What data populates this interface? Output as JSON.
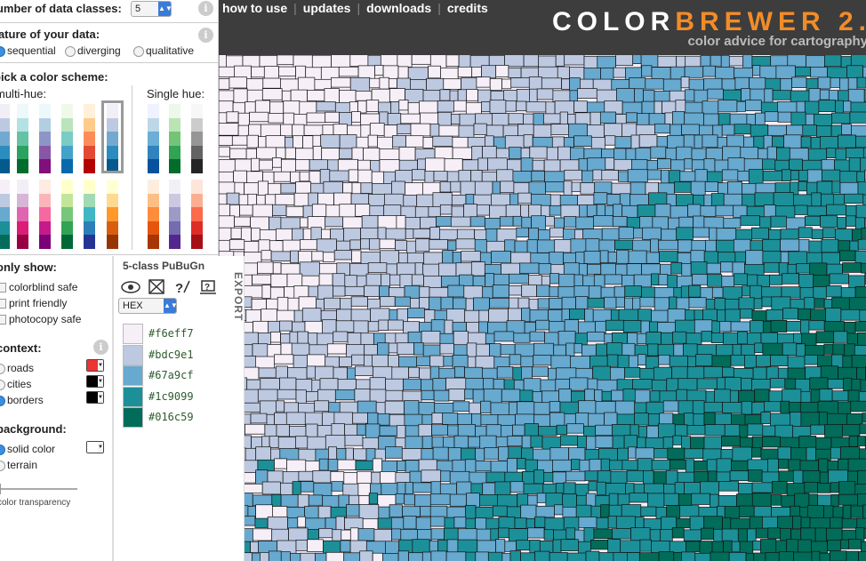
{
  "nav": {
    "items": [
      "how to use",
      "updates",
      "downloads",
      "credits"
    ]
  },
  "brand": {
    "title_a": "COLOR",
    "title_b": "BREWER 2.",
    "tagline": "color advice for cartography"
  },
  "classes": {
    "label": "number of data classes:",
    "value": "5"
  },
  "nature": {
    "label": "nature of your data:",
    "options": [
      "sequential",
      "diverging",
      "qualitative"
    ],
    "selected": "sequential"
  },
  "scheme": {
    "label": "pick a color scheme:",
    "multi_label": "multi-hue:",
    "single_label": "Single hue:"
  },
  "show": {
    "label": "only show:",
    "options": [
      "colorblind safe",
      "print friendly",
      "photocopy safe"
    ]
  },
  "context": {
    "label": "context:",
    "items": [
      "roads",
      "cities",
      "borders"
    ],
    "colors": [
      "#ee3333",
      "#000000",
      "#000000"
    ]
  },
  "background": {
    "label": "background:",
    "options": [
      "solid color",
      "terrain"
    ],
    "transparency_label": "color transparency"
  },
  "legend": {
    "title": "5-class PuBuGn",
    "format": "HEX",
    "export": "EXPORT",
    "colors": [
      "#f6eff7",
      "#bdc9e1",
      "#67a9cf",
      "#1c9099",
      "#016c59"
    ]
  },
  "multi_hue": [
    [
      "#f1eef6",
      "#bdc9e1",
      "#74a9cf",
      "#2b8cbe",
      "#045a8d"
    ],
    [
      "#edf8fb",
      "#b2e2e2",
      "#66c2a4",
      "#2ca25f",
      "#006d2c"
    ],
    [
      "#edf8fb",
      "#b3cde3",
      "#8c96c6",
      "#8856a7",
      "#810f7c"
    ],
    [
      "#f0f9e8",
      "#bae4bc",
      "#7bccc4",
      "#43a2ca",
      "#0868ac"
    ],
    [
      "#fef0d9",
      "#fdcc8a",
      "#fc8d59",
      "#e34a33",
      "#b30000"
    ],
    [
      "#f1eef6",
      "#bdc9e1",
      "#74a9cf",
      "#2b8cbe",
      "#045a8d"
    ],
    [
      "#f6eff7",
      "#bdc9e1",
      "#67a9cf",
      "#1c9099",
      "#016c59"
    ],
    [
      "#f1eef6",
      "#d7b5d8",
      "#df65b0",
      "#dd1c77",
      "#980043"
    ],
    [
      "#feebe2",
      "#fbb4b9",
      "#f768a1",
      "#c51b8a",
      "#7a0177"
    ],
    [
      "#ffffcc",
      "#c2e699",
      "#78c679",
      "#31a354",
      "#006837"
    ],
    [
      "#ffffcc",
      "#a1dab4",
      "#41b6c4",
      "#2c7fb8",
      "#253494"
    ],
    [
      "#ffffd4",
      "#fed98e",
      "#fe9929",
      "#d95f0e",
      "#993404"
    ],
    [
      "#ffffb2",
      "#fecc5c",
      "#fd8d3c",
      "#f03b20",
      "#bd0026"
    ]
  ],
  "single_hue": [
    [
      "#eff3ff",
      "#bdd7e7",
      "#6baed6",
      "#3182bd",
      "#08519c"
    ],
    [
      "#edf8e9",
      "#bae4b3",
      "#74c476",
      "#31a354",
      "#006d2c"
    ],
    [
      "#f7f7f7",
      "#cccccc",
      "#969696",
      "#636363",
      "#252525"
    ],
    [
      "#feedde",
      "#fdbe85",
      "#fd8d3c",
      "#e6550d",
      "#a63603"
    ],
    [
      "#f2f0f7",
      "#cbc9e2",
      "#9e9ac8",
      "#756bb1",
      "#54278f"
    ],
    [
      "#fee5d9",
      "#fcae91",
      "#fb6a4a",
      "#de2d26",
      "#a50f15"
    ]
  ]
}
